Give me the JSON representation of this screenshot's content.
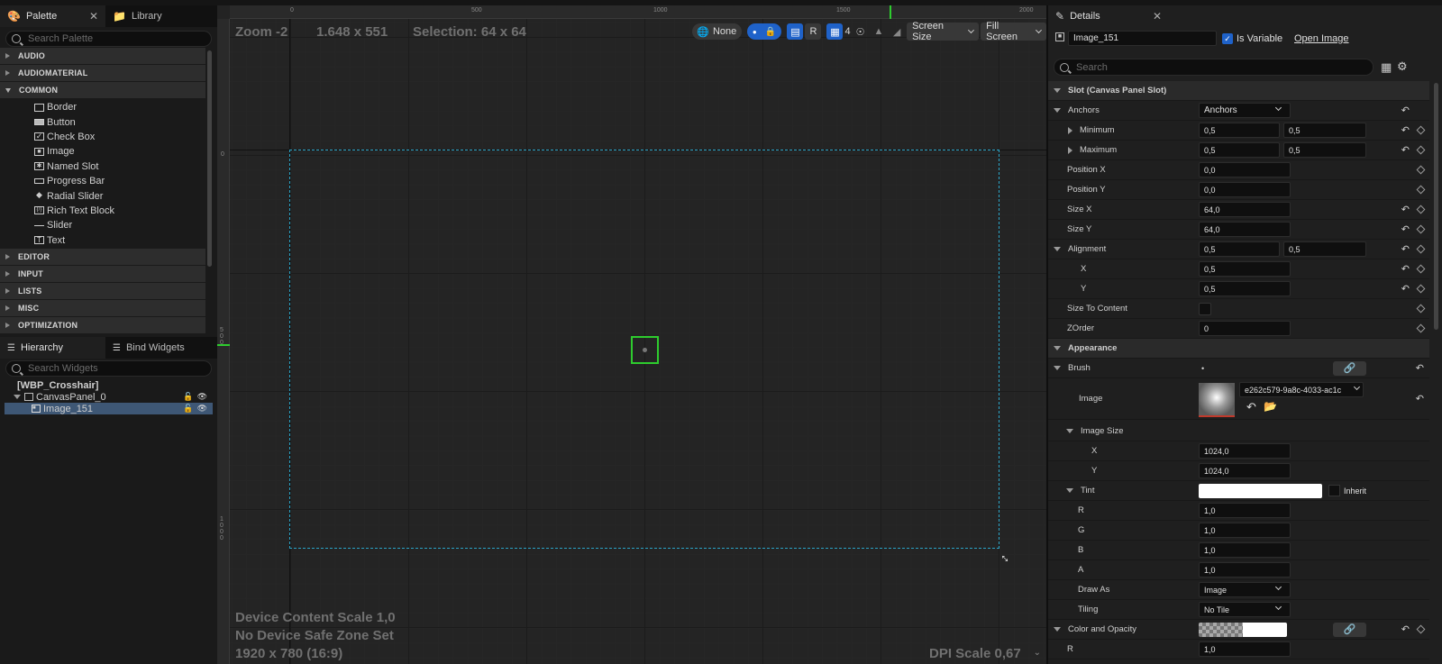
{
  "palette": {
    "tab_label": "Palette",
    "library_tab_label": "Library",
    "search_placeholder": "Search Palette",
    "categories": [
      "AUDIO",
      "AUDIOMATERIAL",
      "COMMON",
      "EDITOR",
      "INPUT",
      "LISTS",
      "MISC",
      "OPTIMIZATION"
    ],
    "common_items": [
      "Border",
      "Button",
      "Check Box",
      "Image",
      "Named Slot",
      "Progress Bar",
      "Radial Slider",
      "Rich Text Block",
      "Slider",
      "Text"
    ]
  },
  "hierarchy": {
    "tab_label": "Hierarchy",
    "bind_tab_label": "Bind Widgets",
    "search_placeholder": "Search Widgets",
    "root": "[WBP_Crosshair]",
    "canvas_panel": "CanvasPanel_0",
    "selected_item": "Image_151"
  },
  "canvas": {
    "zoom": "Zoom -2",
    "resolution": "1.648 x 551",
    "selection": "Selection: 64 x 64",
    "ruler_top": [
      "0",
      "500",
      "1000",
      "1500",
      "2000"
    ],
    "toolbar": {
      "none_label": "None",
      "r_label": "R",
      "grid_count": "4",
      "screen_size": "Screen Size",
      "fill_screen": "Fill Screen"
    },
    "device_content_scale": "Device Content Scale 1,0",
    "safe_zone": "No Device Safe Zone Set",
    "bottom_partial": "1920 x 780 (16:9)",
    "dpi_partial": "DPI Scale 0,67"
  },
  "details": {
    "tab_label": "Details",
    "widget_name": "Image_151",
    "is_variable_label": "Is Variable",
    "open_image_label": "Open Image",
    "search_placeholder": "Search",
    "slot_section": "Slot (Canvas Panel Slot)",
    "anchors_label": "Anchors",
    "anchors_value": "Anchors",
    "minimum_label": "Minimum",
    "minimum_x": "0,5",
    "minimum_y": "0,5",
    "maximum_label": "Maximum",
    "maximum_x": "0,5",
    "maximum_y": "0,5",
    "position_x_label": "Position X",
    "position_x": "0,0",
    "position_y_label": "Position Y",
    "position_y": "0,0",
    "size_x_label": "Size X",
    "size_x": "64,0",
    "size_y_label": "Size Y",
    "size_y": "64,0",
    "alignment_label": "Alignment",
    "alignment_a": "0,5",
    "alignment_b": "0,5",
    "align_x_label": "X",
    "align_x": "0,5",
    "align_y_label": "Y",
    "align_y": "0,5",
    "size_to_content_label": "Size To Content",
    "zorder_label": "ZOrder",
    "zorder": "0",
    "appearance_section": "Appearance",
    "brush_label": "Brush",
    "image_label": "Image",
    "image_asset": "e262c579-9a8c-4033-ac1c",
    "image_size_label": "Image Size",
    "image_size_x_label": "X",
    "image_size_x": "1024,0",
    "image_size_y_label": "Y",
    "image_size_y": "1024,0",
    "tint_label": "Tint",
    "inherit_label": "Inherit",
    "r_label": "R",
    "r": "1,0",
    "g_label": "G",
    "g": "1,0",
    "b_label": "B",
    "b": "1,0",
    "a_label": "A",
    "a": "1,0",
    "draw_as_label": "Draw As",
    "draw_as": "Image",
    "tiling_label": "Tiling",
    "tiling": "No Tile",
    "color_opacity_label": "Color and Opacity",
    "partial_r_label": "R",
    "partial_r": "1,0"
  },
  "colors": {
    "accent_blue": "#1f62c9",
    "selection_green": "#2ecc2e",
    "canvas_outline": "#2aa3c6",
    "selected_row": "#3e5775"
  }
}
